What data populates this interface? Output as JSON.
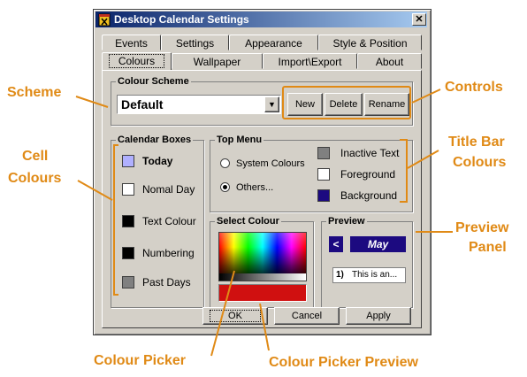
{
  "window": {
    "title": "Desktop Calendar Settings",
    "close_glyph": "✕"
  },
  "tabs": {
    "row1": [
      "Events",
      "Settings",
      "Appearance",
      "Style & Position"
    ],
    "row2": [
      "Colours",
      "Wallpaper",
      "Import\\Export",
      "About"
    ],
    "active": "Colours"
  },
  "colour_scheme": {
    "group_label": "Colour Scheme",
    "selected": "Default",
    "buttons": {
      "new": "New",
      "delete": "Delete",
      "rename": "Rename"
    }
  },
  "calendar_boxes": {
    "group_label": "Calendar Boxes",
    "items": [
      {
        "label": "Today",
        "color": "#b0b0ff"
      },
      {
        "label": "Nomal Day",
        "color": "#ffffff"
      },
      {
        "label": "Text Colour",
        "color": "#000000"
      },
      {
        "label": "Numbering",
        "color": "#000000"
      },
      {
        "label": "Past Days",
        "color": "#808080"
      }
    ]
  },
  "top_menu": {
    "group_label": "Top Menu",
    "radio_system": "System Colours",
    "radio_others": "Others...",
    "selected": "Others...",
    "items": [
      {
        "label": "Inactive Text",
        "color": "#808080"
      },
      {
        "label": "Foreground",
        "color": "#ffffff"
      },
      {
        "label": "Background",
        "color": "#1c0a80"
      }
    ]
  },
  "select_colour": {
    "group_label": "Select Colour",
    "preview_color": "#d01010"
  },
  "preview": {
    "group_label": "Preview",
    "nav_glyph": "<",
    "month": "May",
    "entry_number": "1)",
    "entry_text": "This is an..."
  },
  "footer": {
    "ok": "OK",
    "cancel": "Cancel",
    "apply": "Apply"
  },
  "annotations": {
    "scheme": "Scheme",
    "controls": "Controls",
    "cell_colours_1": "Cell",
    "cell_colours_2": "Colours",
    "title_bar_1": "Title Bar",
    "title_bar_2": "Colours",
    "preview_panel_1": "Preview",
    "preview_panel_2": "Panel",
    "colour_picker": "Colour Picker",
    "colour_picker_preview": "Colour Picker Preview",
    "accent_color": "#e08a16"
  }
}
